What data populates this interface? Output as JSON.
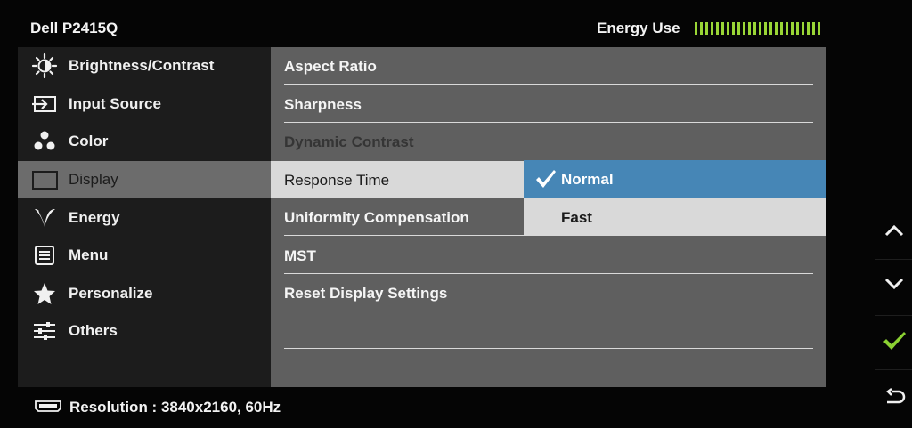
{
  "header": {
    "model": "Dell P2415Q",
    "energy_label": "Energy Use",
    "energy_color": "#9ad636"
  },
  "sidebar": {
    "items": [
      {
        "label": "Brightness/Contrast",
        "icon": "brightness-icon"
      },
      {
        "label": "Input Source",
        "icon": "input-source-icon"
      },
      {
        "label": "Color",
        "icon": "color-icon"
      },
      {
        "label": "Display",
        "icon": "display-icon",
        "active": true
      },
      {
        "label": "Energy",
        "icon": "energy-icon"
      },
      {
        "label": "Menu",
        "icon": "menu-icon"
      },
      {
        "label": "Personalize",
        "icon": "star-icon"
      },
      {
        "label": "Others",
        "icon": "sliders-icon"
      }
    ]
  },
  "display_menu": {
    "rows": [
      {
        "label": "Aspect Ratio"
      },
      {
        "label": "Sharpness"
      },
      {
        "label": "Dynamic Contrast",
        "disabled": true
      },
      {
        "label": "Response Time",
        "selected": true
      },
      {
        "label": "Uniformity Compensation"
      },
      {
        "label": "MST"
      },
      {
        "label": "Reset Display Settings"
      },
      {
        "label": ""
      }
    ]
  },
  "response_time": {
    "options": [
      {
        "label": "Normal",
        "checked": true
      },
      {
        "label": "Fast"
      }
    ],
    "highlight_color": "#4686b6"
  },
  "status": {
    "resolution_text": "Resolution : 3840x2160, 60Hz"
  },
  "buttons": {
    "up": "chevron-up-icon",
    "down": "chevron-down-icon",
    "ok": "check-icon",
    "back": "back-icon",
    "ok_color": "#8bd132"
  }
}
